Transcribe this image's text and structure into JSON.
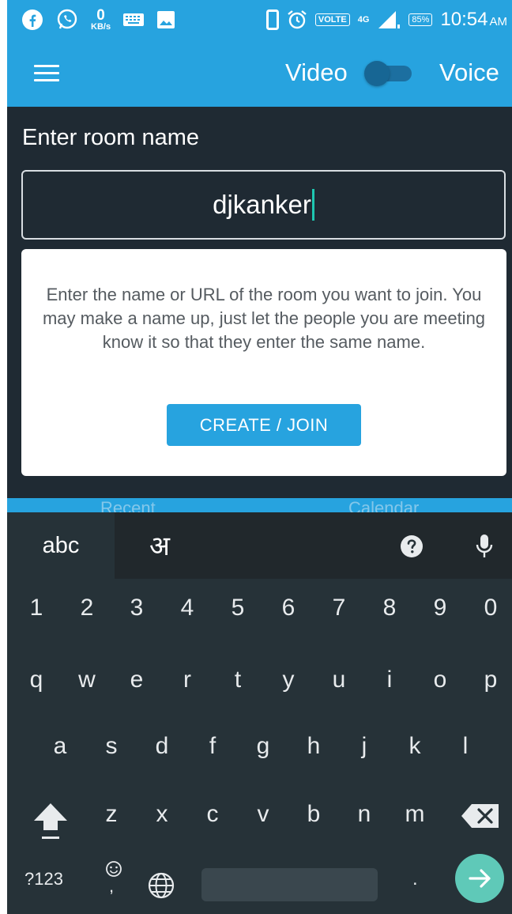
{
  "status_bar": {
    "kb_speed_value": "0",
    "kb_speed_unit": "KB/s",
    "volte": "VOLTE",
    "network": "4G",
    "battery": "85%",
    "time": "10:54",
    "ampm": "AM",
    "icons": [
      "facebook-icon",
      "whatsapp-icon",
      "keyboard-icon",
      "gallery-icon",
      "phone-icon",
      "alarm-icon",
      "signal-icon",
      "battery-icon"
    ]
  },
  "app_bar": {
    "video_label": "Video",
    "voice_label": "Voice",
    "toggle_on": false
  },
  "main": {
    "room_label": "Enter room name",
    "room_value": "djkanker",
    "help_text": "Enter the name or URL of the room you want to join. You may make a name up, just let the people you are meeting know it so that they enter the same name.",
    "join_button": "CREATE / JOIN"
  },
  "bottom_tabs": [
    "Recent",
    "Calendar"
  ],
  "keyboard": {
    "abc": "abc",
    "hindi": "अ",
    "numbers": [
      "1",
      "2",
      "3",
      "4",
      "5",
      "6",
      "7",
      "8",
      "9",
      "0"
    ],
    "row1": [
      "q",
      "w",
      "e",
      "r",
      "t",
      "y",
      "u",
      "i",
      "o",
      "p"
    ],
    "row2": [
      "a",
      "s",
      "d",
      "f",
      "g",
      "h",
      "j",
      "k",
      "l"
    ],
    "row3": [
      "z",
      "x",
      "c",
      "v",
      "b",
      "n",
      "m"
    ],
    "symbols": "?123",
    "period": ".",
    "comma": ","
  },
  "colors": {
    "primary": "#27a3df",
    "background": "#1f2a33",
    "keyboard": "#263238",
    "enter_key": "#5fc9b8",
    "caret": "#1ec7b1"
  }
}
